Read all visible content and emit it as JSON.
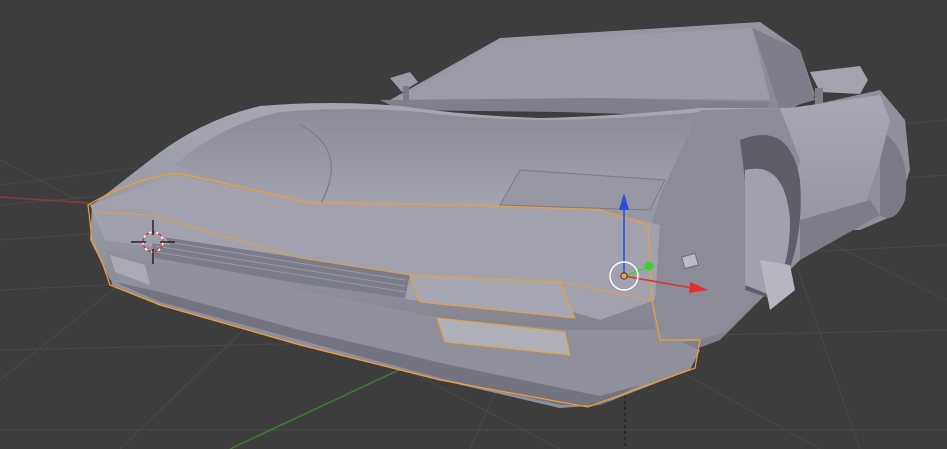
{
  "viewport": {
    "background": "#3d3d3d",
    "grid_color": "#494949",
    "x_axis_color": "#8a3a3a",
    "y_axis_color": "#3f7a33",
    "selection_outline": "#f0a030"
  },
  "object": {
    "name": "",
    "body_color": "#8d8e9a",
    "body_light": "#a9aab5",
    "body_dark": "#64656f"
  },
  "manipulator": {
    "x_color": "#e2312b",
    "y_color": "#3ad13a",
    "z_color": "#2a4fd8",
    "pivot_color": "#e8a04a"
  },
  "cursor_3d": {
    "ring_color": "#e03030",
    "icon": "3d-cursor-icon"
  },
  "icons": [
    "3d-cursor-icon",
    "transform-manipulator-icon",
    "object-origin-icon"
  ]
}
